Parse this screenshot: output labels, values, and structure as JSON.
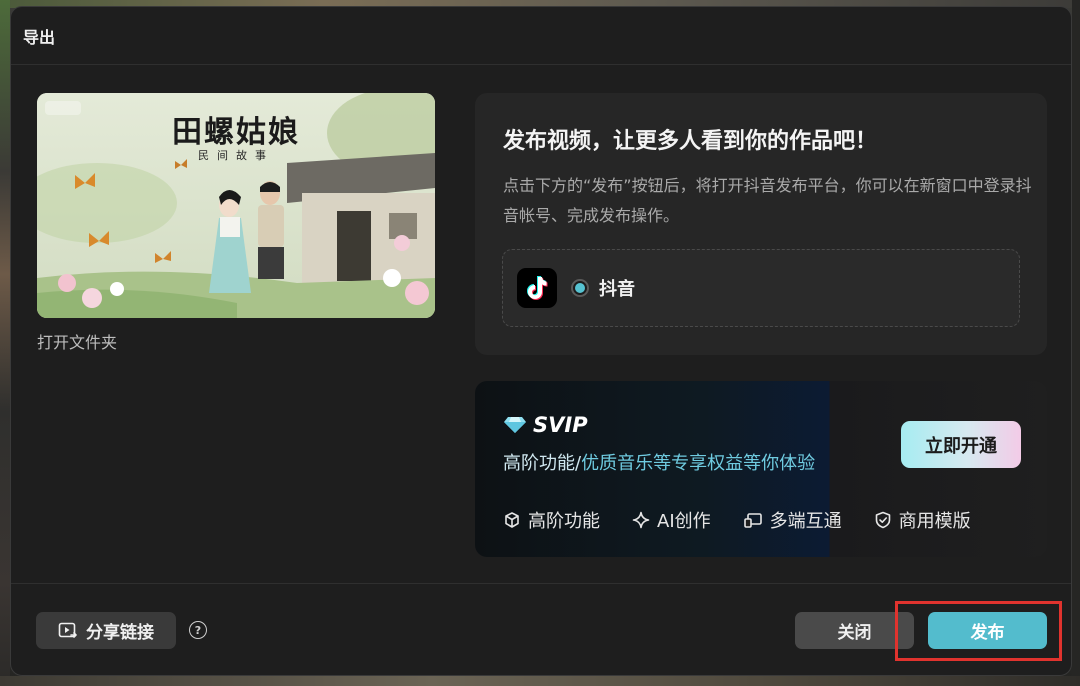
{
  "dialog": {
    "title": "导出"
  },
  "preview": {
    "title": "田螺姑娘",
    "subtitle": "民间故事",
    "open_folder_label": "打开文件夹"
  },
  "publish": {
    "heading": "发布视频，让更多人看到你的作品吧！",
    "description": "点击下方的“发布”按钮后，将打开抖音发布平台，你可以在新窗口中登录抖音帐号、完成发布操作。",
    "platform": {
      "label": "抖音",
      "icon": "douyin-logo-icon",
      "selected": true
    }
  },
  "svip": {
    "logo_text": "SVIP",
    "tagline_prefix": "高阶功能/",
    "tagline_highlight": "优质音乐等专享权益等你体验",
    "activate_label": "立即开通",
    "features": [
      {
        "label": "高阶功能",
        "icon": "cube-icon"
      },
      {
        "label": "AI创作",
        "icon": "sparkle-icon"
      },
      {
        "label": "多端互通",
        "icon": "devices-icon"
      },
      {
        "label": "商用模版",
        "icon": "shield-check-icon"
      }
    ]
  },
  "footer": {
    "share_label": "分享链接",
    "help_icon": "question-circle-icon",
    "close_label": "关闭",
    "publish_label": "发布"
  },
  "colors": {
    "accent": "#53bccd",
    "highlight_annotation": "#e0332e",
    "dialog_bg": "#1e1e1e"
  }
}
